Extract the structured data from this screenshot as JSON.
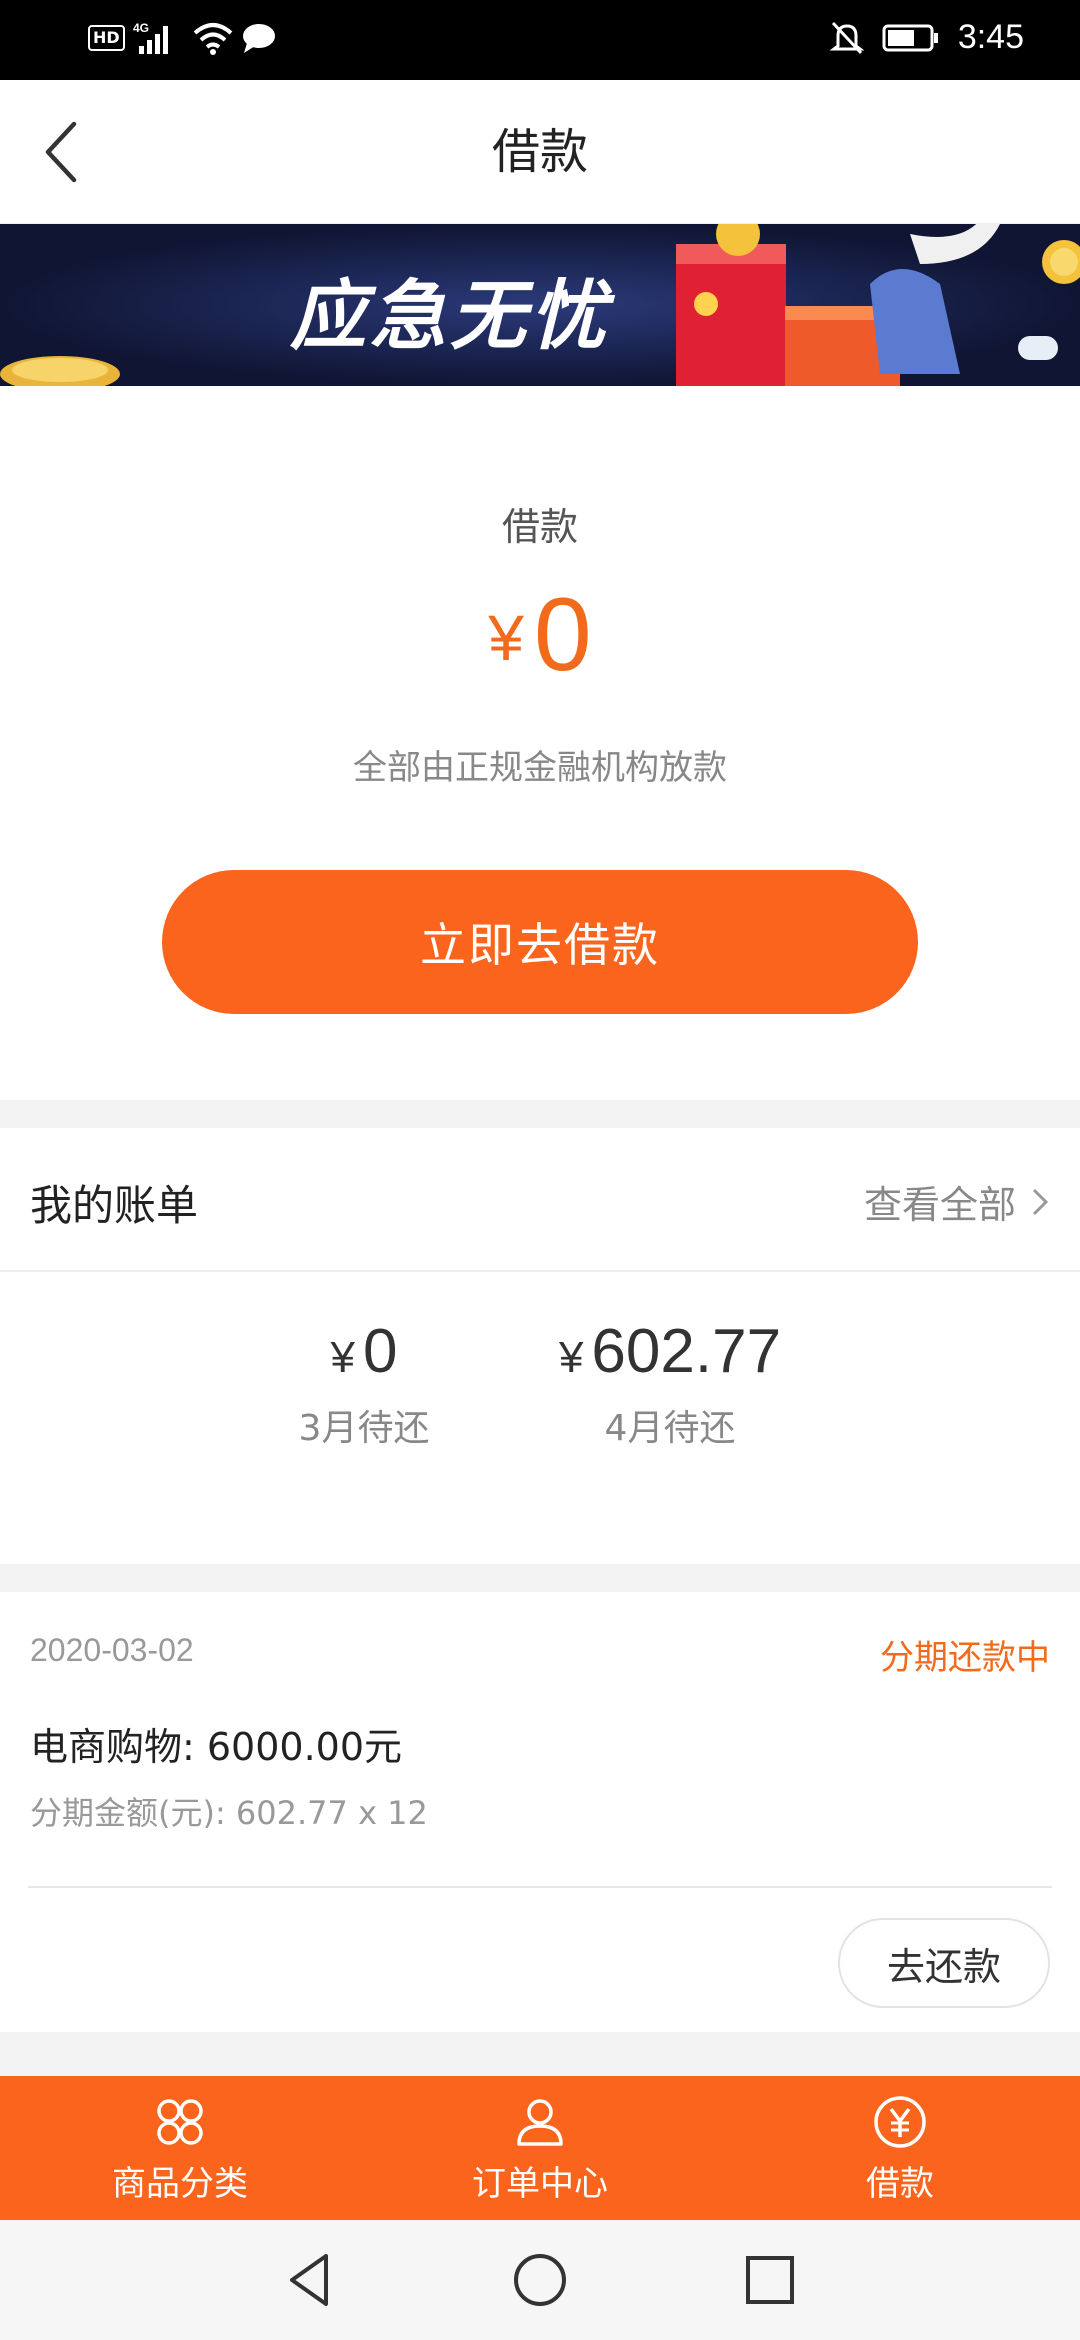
{
  "status_bar": {
    "hd_badge": "HD",
    "network": "4G",
    "time": "3:45",
    "icons": [
      "signal-icon",
      "wifi-icon",
      "message-icon",
      "notifications-off-icon",
      "battery-icon"
    ]
  },
  "nav": {
    "title": "借款",
    "back_icon": "chevron-left-icon"
  },
  "banner": {
    "headline": "应急无忧"
  },
  "loan": {
    "label": "借款",
    "currency": "¥",
    "amount": "0",
    "subtitle": "全部由正规金融机构放款",
    "button_label": "立即去借款"
  },
  "bill": {
    "title": "我的账单",
    "view_all": "查看全部",
    "items": [
      {
        "currency": "¥",
        "amount": "0",
        "label": "3月待还"
      },
      {
        "currency": "¥",
        "amount": "602.77",
        "label": "4月待还"
      }
    ]
  },
  "order": {
    "date": "2020-03-02",
    "status": "分期还款中",
    "title": "电商购物: 6000.00元",
    "installment": "分期金额(元): 602.77 x 12",
    "repay_button": "去还款"
  },
  "tabs": [
    {
      "label": "商品分类",
      "icon": "grid-icon"
    },
    {
      "label": "订单中心",
      "icon": "user-icon"
    },
    {
      "label": "借款",
      "icon": "yuan-icon"
    }
  ],
  "colors": {
    "accent": "#fb641c",
    "accent_text": "#f26a1b",
    "status_bar": "#000000"
  }
}
